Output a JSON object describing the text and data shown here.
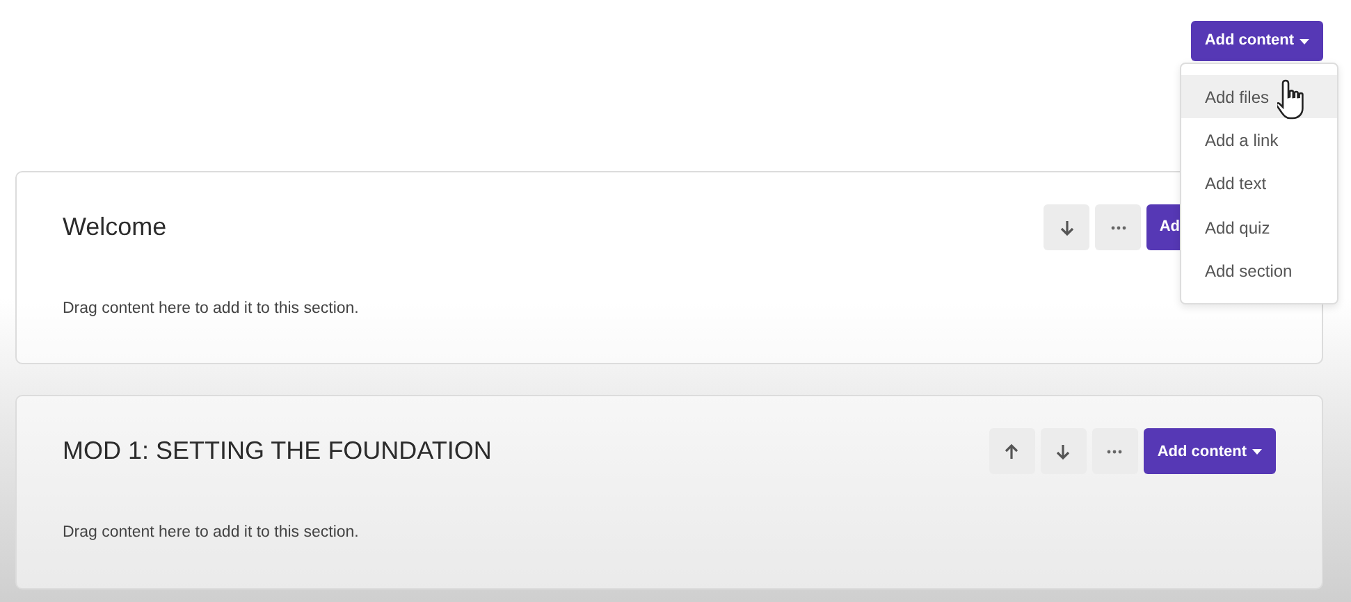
{
  "header": {
    "add_button": {
      "label": "Add content"
    }
  },
  "menu": {
    "items": [
      {
        "label": "Add files",
        "hovered": true
      },
      {
        "label": "Add a link",
        "hovered": false
      },
      {
        "label": "Add text",
        "hovered": false
      },
      {
        "label": "Add quiz",
        "hovered": false
      },
      {
        "label": "Add section",
        "hovered": false
      }
    ]
  },
  "sections": [
    {
      "title": "Welcome",
      "hint": "Drag content here to add it to this section.",
      "actions": [
        {
          "kind": "down"
        },
        {
          "kind": "more"
        },
        {
          "kind": "add_cut",
          "label": "Ad"
        }
      ]
    },
    {
      "title": "MOD 1: SETTING THE FOUNDATION",
      "hint": "Drag content here to add it to this section.",
      "actions": [
        {
          "kind": "up"
        },
        {
          "kind": "down"
        },
        {
          "kind": "more"
        },
        {
          "kind": "add",
          "label": "Add content"
        }
      ]
    }
  ]
}
